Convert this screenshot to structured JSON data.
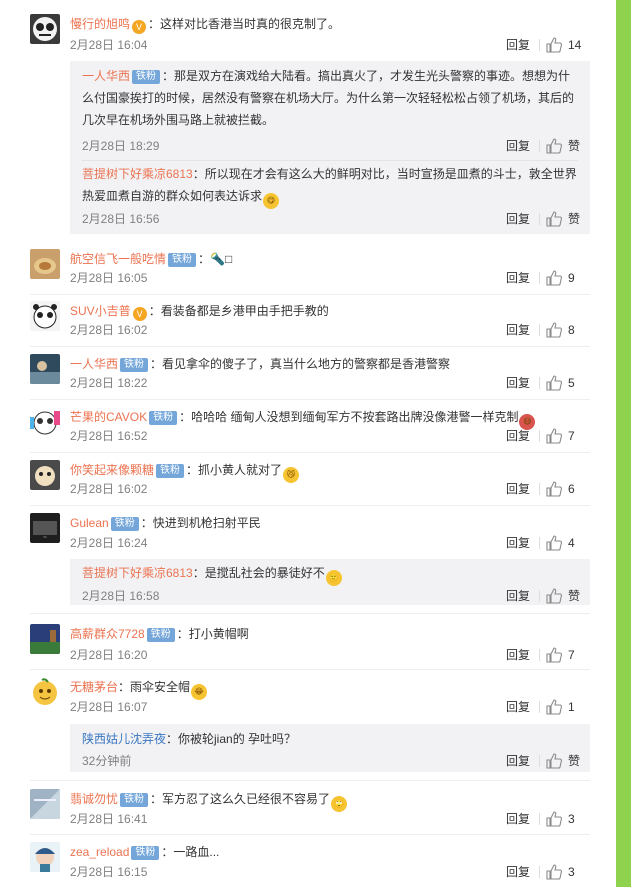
{
  "actions": {
    "reply": "回复",
    "like_label": "赞"
  },
  "comments": [
    {
      "user": "慢行的旭鸣",
      "badge": "",
      "vip": "V",
      "text": "：这样对比香港当时真的很克制了。",
      "emoji": "",
      "time": "2月28日 16:04",
      "likes": "14",
      "replies": [
        {
          "user": "一人华西",
          "badge": "铁粉",
          "text": "：那是双方在演戏给大陆看。搞出真火了，才发生光头警察的事迹。想想为什么付国豪挨打的时候，居然没有警察在机场大厅。为什么第一次轻轻松松占领了机场，其后的几次早在机场外围马路上就被拦截。",
          "time": "2月28日 18:29",
          "likes": "赞"
        },
        {
          "user": "菩提树下好乘凉6813",
          "badge": "",
          "text": "：所以现在才会有这么大的鲜明对比，当时宣扬是皿煮的斗士，敦全世界热爱皿煮自游的群众如何表达诉求",
          "emoji": "😋",
          "time": "2月28日 16:56",
          "likes": "赞"
        }
      ]
    },
    {
      "user": "航空信飞一般吃情",
      "badge": "铁粉",
      "vip": "",
      "text": "：🔦□",
      "emoji": "",
      "time": "2月28日 16:05",
      "likes": "9",
      "replies": []
    },
    {
      "user": "SUV小吉普",
      "badge": "",
      "vip": "V",
      "text": "：看装备都是乡港甲由手把手教的",
      "emoji": "",
      "time": "2月28日 16:02",
      "likes": "8",
      "replies": []
    },
    {
      "user": "一人华西",
      "badge": "铁粉",
      "vip": "",
      "text": "：看见拿伞的傻子了，真当什么地方的警察都是香港警察",
      "emoji": "",
      "time": "2月28日 18:22",
      "likes": "5",
      "replies": []
    },
    {
      "user": "芒果的CAVOK",
      "badge": "铁粉",
      "vip": "",
      "text": "：哈哈哈 缅甸人没想到缅甸军方不按套路出牌没像港警一样克制",
      "emoji": "😷",
      "time": "2月28日 16:52",
      "likes": "7",
      "replies": []
    },
    {
      "user": "你笑起来像颗糖",
      "badge": "铁粉",
      "vip": "",
      "text": "：抓小黄人就对了",
      "emoji": "😼",
      "time": "2月28日 16:02",
      "likes": "6",
      "replies": []
    },
    {
      "user": "Gulean",
      "badge": "铁粉",
      "vip": "",
      "text": "：快进到机枪扫射平民",
      "emoji": "",
      "time": "2月28日 16:24",
      "likes": "4",
      "replies": [
        {
          "user": "菩提树下好乘凉6813",
          "badge": "",
          "text": "：是搅乱社会的暴徒好不",
          "emoji": "🙂",
          "time": "2月28日 16:58",
          "likes": "赞"
        }
      ]
    },
    {
      "user": "高薪群众7728",
      "badge": "铁粉",
      "vip": "",
      "text": "：打小黄帽啊",
      "emoji": "",
      "time": "2月28日 16:20",
      "likes": "7",
      "replies": []
    },
    {
      "user": "无糖茅台",
      "badge": "",
      "vip": "",
      "text": "：雨伞安全帽",
      "emoji": "😂",
      "time": "2月28日 16:07",
      "likes": "1",
      "replies": [
        {
          "user": "陕西姑儿沈弄夜",
          "badge": "",
          "text": "：你被轮jian的 孕吐吗？",
          "emoji": "",
          "time": "32分钟前",
          "likes": "赞"
        }
      ]
    },
    {
      "user": "翡诚勿忧",
      "badge": "铁粉",
      "vip": "",
      "text": "：军方忍了这么久已经很不容易了",
      "emoji": "🙄",
      "time": "2月28日 16:41",
      "likes": "3",
      "replies": []
    },
    {
      "user": "zea_reload",
      "badge": "铁粉",
      "vip": "",
      "text": "：一路血...",
      "emoji": "",
      "time": "2月28日 16:15",
      "likes": "3",
      "replies": []
    }
  ]
}
